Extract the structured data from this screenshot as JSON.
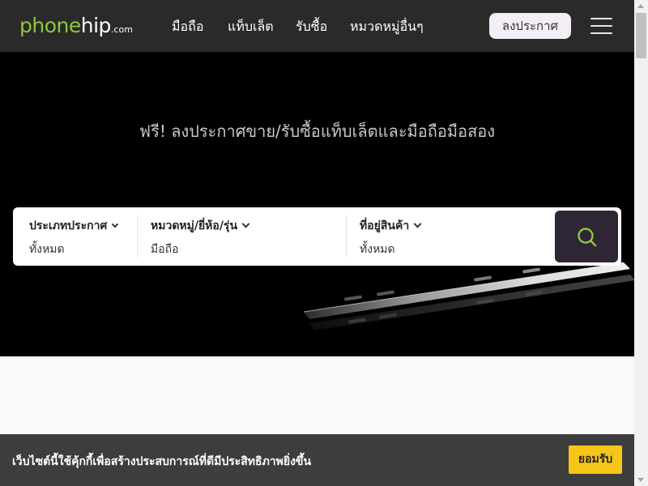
{
  "brand": {
    "logo_part1": "phone",
    "logo_part2": "hip",
    "logo_suffix": ".com",
    "accent_color": "#8cc63f"
  },
  "nav": {
    "items": [
      {
        "label": "มือถือ"
      },
      {
        "label": "แท็บเล็ต"
      },
      {
        "label": "รับซื้อ"
      },
      {
        "label": "หมวดหมู่อื่นๆ"
      }
    ],
    "post_button": "ลงประกาศ",
    "menu_icon": "hamburger-menu-icon"
  },
  "hero": {
    "title": "ฟรี! ลงประกาศขาย/รับซื้อแท็บเล็ตและมือถือมือสอง"
  },
  "search": {
    "fields": [
      {
        "label": "ประเภทประกาศ",
        "value": "ทั้งหมด"
      },
      {
        "label": "หมวดหมู่/ยี่ห้อ/รุ่น",
        "value": "มือถือ"
      },
      {
        "label": "ที่อยู่สินค้า",
        "value": "ทั้งหมด"
      }
    ],
    "button_icon": "search-icon",
    "button_color": "#2e2535"
  },
  "cookie": {
    "message": "เว็บไซต์นี้ใช้คุ้กกี้เพื่อสร้างประสบการณ์ที่ดีมีประสิทธิภาพยิ่งขึ้น",
    "accept_label": "ยอมรับ",
    "accept_color": "#f5c518"
  }
}
